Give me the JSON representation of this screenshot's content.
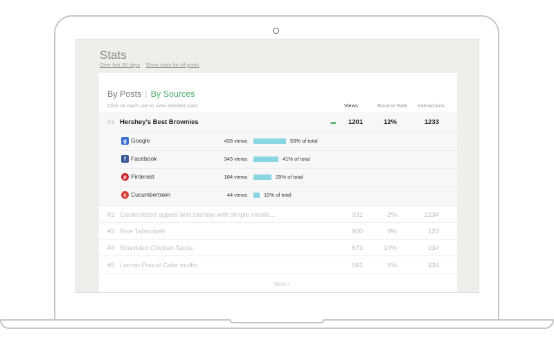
{
  "header": {
    "title": "Stats",
    "link_range": "Over last 30 days",
    "link_all": "Show stats for all posts"
  },
  "tabs": {
    "posts": "By Posts",
    "sources": "By Sources"
  },
  "hint": "Click on each row to view detailed stats",
  "columns": {
    "views": "Views",
    "bounce": "Bounce Rate",
    "interactions": "Interactions"
  },
  "rows": [
    {
      "rank": "#1",
      "title": "Hershey's Best Brownies",
      "views": "1201",
      "bounce": "12%",
      "interactions": "1233"
    },
    {
      "rank": "#2",
      "title": "Caramelized apples and cashew with simple vanilla...",
      "views": "931",
      "bounce": "2%",
      "interactions": "2234"
    },
    {
      "rank": "#3",
      "title": "Rice Tabbouleh",
      "views": "900",
      "bounce": "9%",
      "interactions": "123"
    },
    {
      "rank": "#4",
      "title": "Shredded Chicken Tacos",
      "views": "673",
      "bounce": "10%",
      "interactions": "234"
    },
    {
      "rank": "#5",
      "title": "Lemon Pound Cake muffin",
      "views": "562",
      "bounce": "1%",
      "interactions": "434"
    }
  ],
  "sources": [
    {
      "name": "Google",
      "views": "435 views",
      "pct": "53% of total",
      "share": 0.53,
      "icon": "google-icon",
      "color": "#3b6fd4",
      "glyph": "g"
    },
    {
      "name": "Facebook",
      "views": "345 views",
      "pct": "41% of total",
      "share": 0.41,
      "icon": "facebook-icon",
      "color": "#3b5998",
      "glyph": "f"
    },
    {
      "name": "Pinterest",
      "views": "184 views",
      "pct": "29% of total",
      "share": 0.29,
      "icon": "pinterest-icon",
      "color": "#cb2027",
      "glyph": "p"
    },
    {
      "name": "Cucumbertown",
      "views": "44 views",
      "pct": "10% of total",
      "share": 0.1,
      "icon": "cucumbertown-icon",
      "color": "#d83a2f",
      "glyph": "c"
    }
  ],
  "pager": {
    "next": "Next >"
  },
  "colors": {
    "accent": "#4cae6a",
    "bar": "#8ad6e0"
  }
}
